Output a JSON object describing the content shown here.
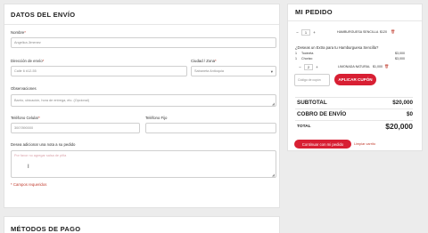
{
  "delivery": {
    "title": "DATOS DEL ENVÍO",
    "nombre_label": "Nombre",
    "nombre_value": "Angelica Jimenez",
    "direccion_label": "Dirección de envío",
    "direccion_placeholder": "Calle 6 #12-55",
    "ciudad_label": "Ciudad / Zona",
    "ciudad_value": "Sabaneta Antioquia",
    "observaciones_label": "Observaciones",
    "observaciones_placeholder": "Barrio, ubicación, hora de entrega, etc. (Opcional)",
    "telefono_label": "Teléfono Celular",
    "telefono_placeholder": "3007890000",
    "telefono_fijo_label": "Teléfono Fijo",
    "nota_label": "Desea adicionar una nota a su pedido",
    "nota_placeholder": "Por favor no agregar salsa de piña",
    "required_note": "* Campos requeridos",
    "required_mark": "*"
  },
  "payment": {
    "title": "MÉTODOS DE PAGO"
  },
  "order": {
    "title": "MI PEDIDO",
    "item1": {
      "qty": "1",
      "minus": "−",
      "plus": "+",
      "name": "HAMBURGUESA SENCILLA",
      "price": "$120"
    },
    "extra_question": "¿Deseas un Extra para tu Hamburguesa Sencilla?",
    "extras": [
      {
        "qty": "1",
        "name": "Tocineta",
        "price": "$3,000"
      },
      {
        "qty": "1",
        "name": "Chorizo",
        "price": "$3,000"
      }
    ],
    "item2": {
      "qty": "2",
      "minus": "−",
      "plus": "+",
      "name": "LIMONADA NATURAL",
      "price": "$1,000"
    },
    "coupon_placeholder": "Código de cupón",
    "coupon_button": "APLICAR CUPÓN",
    "subtotal_label": "SUBTOTAL",
    "subtotal_value": "$20,000",
    "shipping_label": "COBRO DE ENVÍO",
    "shipping_value": "$0",
    "total_label": "TOTAL",
    "total_value": "$20,000",
    "continue_button": "Continuar con mi pedido",
    "clear_link": "Limpiar carrito"
  },
  "colors": {
    "accent": "#d81f33",
    "background": "#ececec"
  }
}
